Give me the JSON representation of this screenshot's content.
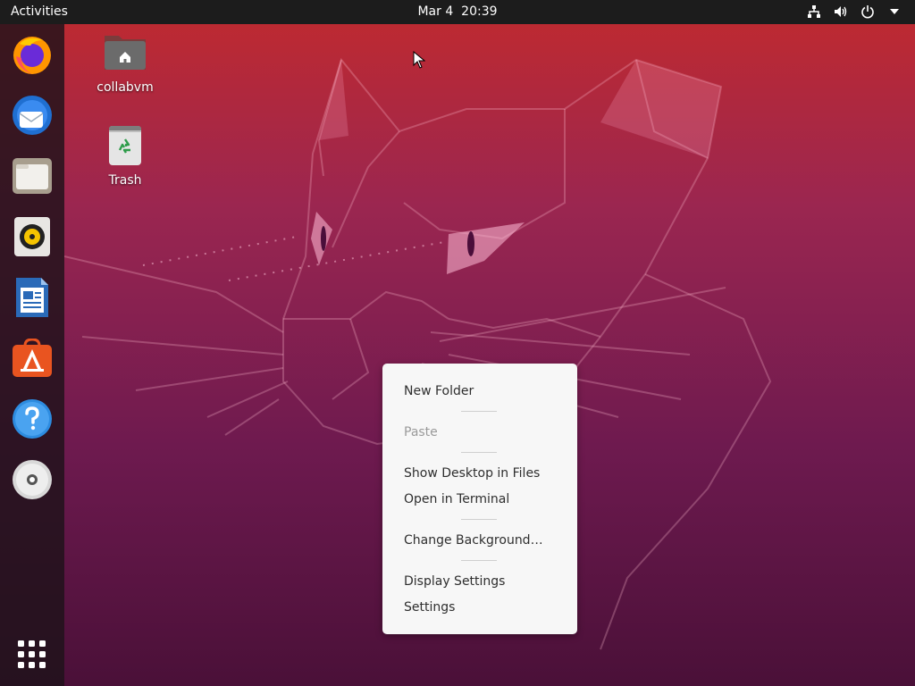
{
  "topbar": {
    "activities": "Activities",
    "date": "Mar 4",
    "time": "20:39",
    "icons": [
      "network-icon",
      "volume-icon",
      "power-icon",
      "dropdown-arrow-icon"
    ]
  },
  "dock": {
    "apps": [
      "firefox-icon",
      "thunderbird-icon",
      "files-icon",
      "rhythmbox-icon",
      "libreoffice-writer-icon",
      "ubuntu-software-icon",
      "help-icon",
      "dvd-icon"
    ],
    "show_apps_icon": "app-grid-icon"
  },
  "desktop": {
    "home_label": "collabvm",
    "trash_label": "Trash"
  },
  "context_menu": {
    "new_folder": "New Folder",
    "paste": "Paste",
    "show_desktop_in_files": "Show Desktop in Files",
    "open_in_terminal": "Open in Terminal",
    "change_background": "Change Background…",
    "display_settings": "Display Settings",
    "settings": "Settings"
  },
  "colors": {
    "topbar": "#1c1c1c",
    "menu_bg": "#f7f7f7",
    "accent": "#e95420"
  }
}
